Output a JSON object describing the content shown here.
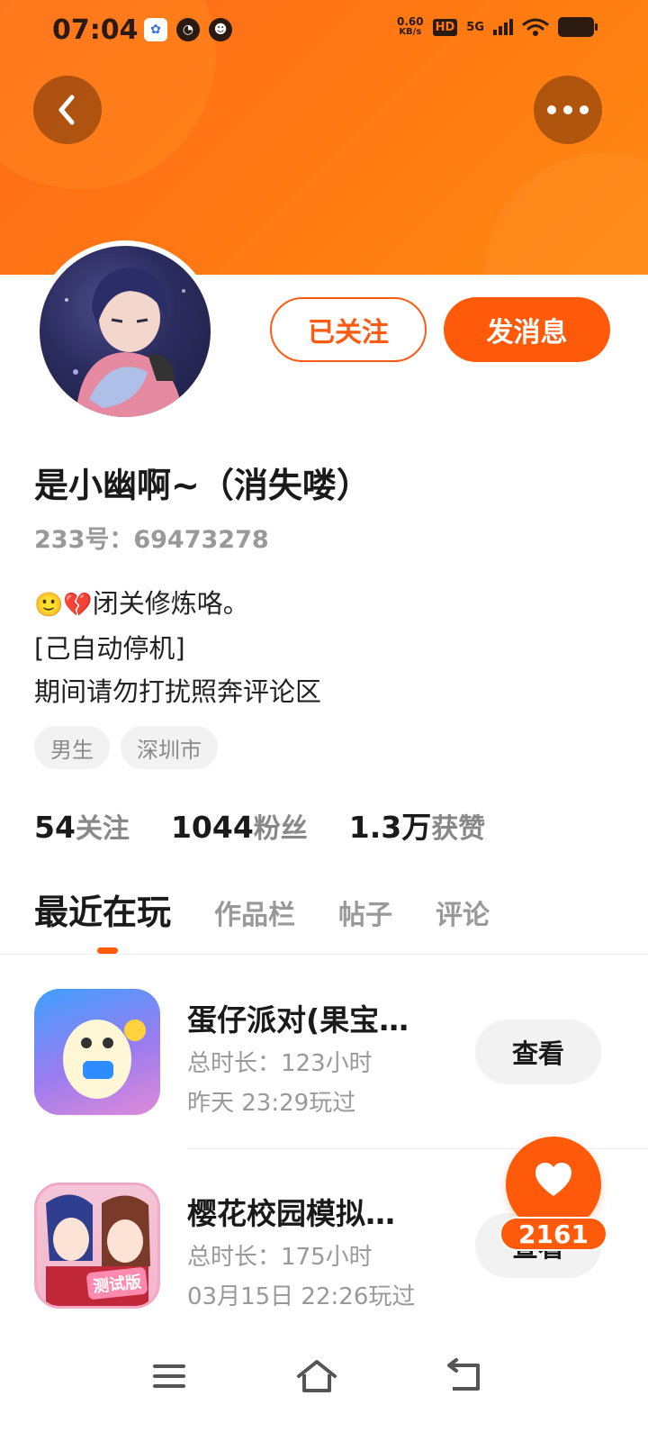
{
  "status_bar": {
    "time": "07:04",
    "net_speed_value": "0.60",
    "net_speed_unit": "KB/s",
    "hd": "HD",
    "network": "5G"
  },
  "profile": {
    "nickname": "是小幽啊~（消失喽）",
    "account_id": "233号：69473278",
    "follow_label": "已关注",
    "message_label": "发消息",
    "bio_line1": "闭关修炼咯。",
    "bio_line2": "[己自动停机]",
    "bio_line3": "期间请勿打扰照奔评论区",
    "tags": [
      "男生",
      "深圳市"
    ],
    "stats": [
      {
        "num": "54",
        "label": "关注"
      },
      {
        "num": "1044",
        "label": "粉丝"
      },
      {
        "num": "1.3万",
        "label": "获赞"
      }
    ]
  },
  "tabs": [
    "最近在玩",
    "作品栏",
    "帖子",
    "评论"
  ],
  "games": [
    {
      "title": "蛋仔派对(果宝…",
      "duration": "总时长：123小时",
      "last_played": "昨天 23:29玩过",
      "button": "查看"
    },
    {
      "title": "樱花校园模拟…",
      "duration": "总时长：175小时",
      "last_played": "03月15日 22:26玩过",
      "button": "查看",
      "icon_badge": "测试版"
    }
  ],
  "like_count": "2161",
  "colors": {
    "accent": "#ff5a0a",
    "header": "#ff7a12"
  }
}
